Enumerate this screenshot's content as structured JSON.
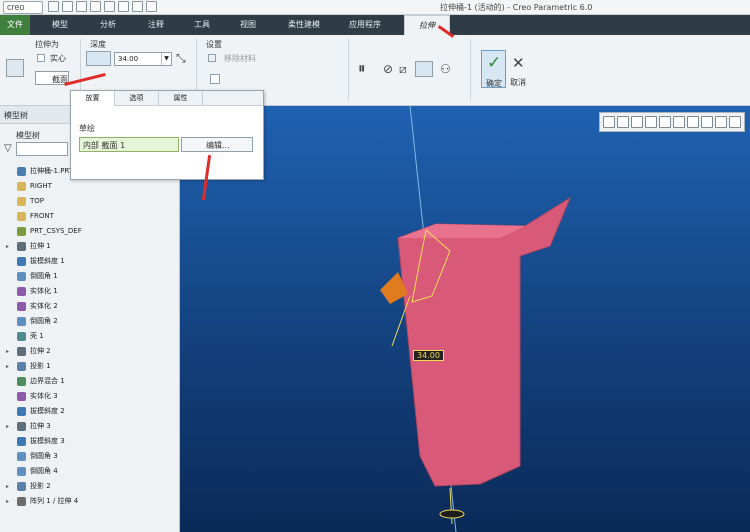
{
  "app": {
    "logo": "creo",
    "window_title": "拉伸桶-1 (活动的) - Creo Parametric 6.0"
  },
  "menubar": {
    "tabs": [
      "文件",
      "模型",
      "分析",
      "注释",
      "工具",
      "视图",
      "柔性建模",
      "应用程序",
      "拉伸"
    ]
  },
  "ribbon": {
    "extrude_as": "拉伸为",
    "solid_label": "实心",
    "section_label": "截面",
    "depth_label": "深度",
    "depth_value": "34.00",
    "settings_label": "设置",
    "remove_material": "移除材料",
    "ok_label": "确定",
    "cancel_label": "取消"
  },
  "popup": {
    "tabs": [
      "放置",
      "选项",
      "属性"
    ],
    "sketch_heading": "草绘",
    "sketch_value": "内部 截面 1",
    "edit_button": "编辑..."
  },
  "panel": {
    "tab_label": "模型树",
    "tree_title": "模型树",
    "items": [
      {
        "label": "拉伸桶-1.PRT",
        "icon": "part-icon",
        "expand": false
      },
      {
        "label": "RIGHT",
        "icon": "plane-icon",
        "expand": false
      },
      {
        "label": "TOP",
        "icon": "plane-icon",
        "expand": false
      },
      {
        "label": "FRONT",
        "icon": "plane-icon",
        "expand": false
      },
      {
        "label": "PRT_CSYS_DEF",
        "icon": "csys-icon",
        "expand": false
      },
      {
        "label": "拉伸 1",
        "icon": "extrude-icon",
        "expand": true
      },
      {
        "label": "拔模斜度 1",
        "icon": "draft-icon",
        "expand": false
      },
      {
        "label": "倒圆角 1",
        "icon": "round-icon",
        "expand": false
      },
      {
        "label": "实体化 1",
        "icon": "solidify-icon",
        "expand": false
      },
      {
        "label": "实体化 2",
        "icon": "solidify-icon",
        "expand": false
      },
      {
        "label": "倒圆角 2",
        "icon": "round-icon",
        "expand": false
      },
      {
        "label": "壳 1",
        "icon": "shell-icon",
        "expand": false
      },
      {
        "label": "拉伸 2",
        "icon": "extrude-icon",
        "expand": true
      },
      {
        "label": "投影 1",
        "icon": "project-icon",
        "expand": true
      },
      {
        "label": "边界混合 1",
        "icon": "blend-icon",
        "expand": false
      },
      {
        "label": "实体化 3",
        "icon": "solidify-icon",
        "expand": false
      },
      {
        "label": "拔模斜度 2",
        "icon": "draft-icon",
        "expand": false
      },
      {
        "label": "拉伸 3",
        "icon": "extrude-icon",
        "expand": true
      },
      {
        "label": "拔模斜度 3",
        "icon": "draft-icon",
        "expand": false
      },
      {
        "label": "倒圆角 3",
        "icon": "round-icon",
        "expand": false
      },
      {
        "label": "倒圆角 4",
        "icon": "round-icon",
        "expand": false
      },
      {
        "label": "投影 2",
        "icon": "project-icon",
        "expand": true
      },
      {
        "label": "阵列 1 / 拉伸 4",
        "icon": "pattern-icon",
        "expand": true
      }
    ]
  },
  "viewport": {
    "dimension": "34.00"
  }
}
